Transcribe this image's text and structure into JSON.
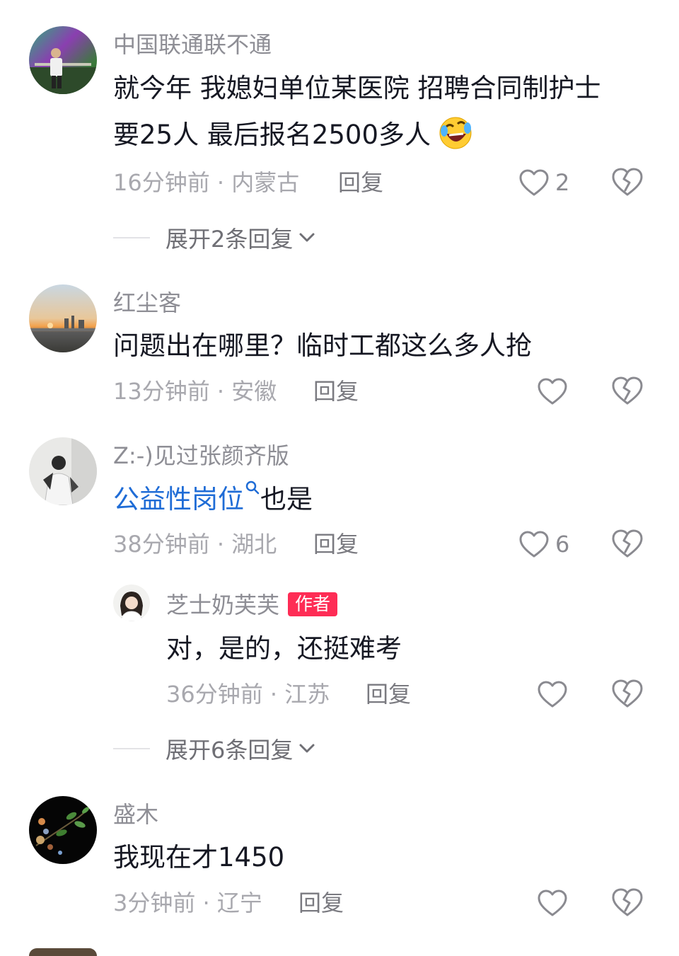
{
  "comments": [
    {
      "username": "中国联通联不通",
      "text_line1": "就今年  我媳妇单位某医院 招聘合同制护士",
      "text_line2": "要25人 最后报名2500多人",
      "emoji": "rolling-on-floor-laughing-emoji",
      "time_location": "16分钟前 · 内蒙古",
      "reply_label": "回复",
      "like_count": "2",
      "expand_label": "展开2条回复"
    },
    {
      "username": "红尘客",
      "text": "问题出在哪里？临时工都这么多人抢",
      "time_location": "13分钟前 · 安徽",
      "reply_label": "回复"
    },
    {
      "username": "Z:-)见过张颜齐版",
      "link_text": "公益性岗位",
      "text_after_link": "也是",
      "time_location": "38分钟前 · 湖北",
      "reply_label": "回复",
      "like_count": "6",
      "sub_reply": {
        "username": "芝士奶芙芙",
        "badge": "作者",
        "text": "对，是的，还挺难考",
        "time_location": "36分钟前 · 江苏",
        "reply_label": "回复"
      },
      "expand_label": "展开6条回复"
    },
    {
      "username": "盛木",
      "text": "我现在才1450",
      "time_location": "3分钟前 · 辽宁",
      "reply_label": "回复"
    }
  ],
  "colors": {
    "author_badge": "#fe2c55",
    "link": "#1f6cd6"
  }
}
